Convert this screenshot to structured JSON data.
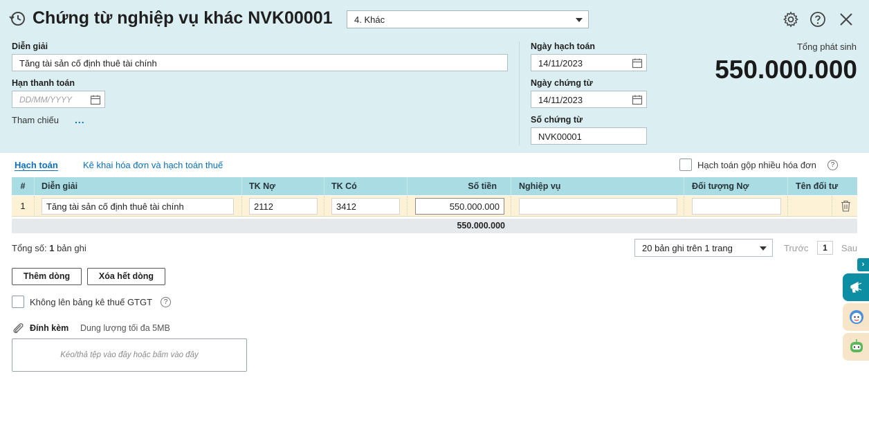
{
  "header": {
    "title": "Chứng từ nghiệp vụ khác NVK00001",
    "type_select": "4. Khác",
    "icons": [
      "history-icon",
      "gear-icon",
      "help-icon",
      "close-icon"
    ]
  },
  "form": {
    "description_label": "Diễn giải",
    "description_value": "Tăng tài sản cố định thuê tài chính",
    "due_date_label": "Hạn thanh toán",
    "due_date_placeholder": "DD/MM/YYYY",
    "reference_label": "Tham chiếu",
    "reference_more": "...",
    "posting_date_label": "Ngày hạch toán",
    "posting_date_value": "14/11/2023",
    "voucher_date_label": "Ngày chứng từ",
    "voucher_date_value": "14/11/2023",
    "voucher_no_label": "Số chứng từ",
    "voucher_no_value": "NVK00001",
    "total_label": "Tổng phát sinh",
    "total_value": "550.000.000"
  },
  "tabs": [
    {
      "label": "Hạch toán",
      "active": true
    },
    {
      "label": "Kê khai hóa đơn và hạch toán thuế",
      "active": false
    }
  ],
  "combine_invoices_label": "Hạch toán gộp nhiều hóa đơn",
  "grid": {
    "columns": [
      "#",
      "Diễn giải",
      "TK Nợ",
      "TK Có",
      "Số tiền",
      "Nghiệp vụ",
      "Đối tượng Nợ",
      "Tên đối tư"
    ],
    "rows": [
      {
        "no": "1",
        "description": "Tăng tài sản cố định thuê tài chính",
        "debit_account": "2112",
        "credit_account": "3412",
        "amount": "550.000.000",
        "operation": "",
        "debit_object": "",
        "object_name": ""
      }
    ],
    "total_amount": "550.000.000"
  },
  "summary": {
    "prefix": "Tổng số:",
    "count": "1",
    "suffix": "bản ghi"
  },
  "pager": {
    "page_size": "20 bản ghi trên 1 trang",
    "prev": "Trước",
    "page": "1",
    "next": "Sau"
  },
  "buttons": {
    "add_row": "Thêm dòng",
    "delete_all": "Xóa hết dòng"
  },
  "vat_checkbox_label": "Không lên bảng kê thuế GTGT",
  "attachment": {
    "label": "Đính kèm",
    "limit": "Dung lượng tối đa 5MB",
    "drop_text": "Kéo/thả tệp vào đây hoặc bấm vào đây"
  },
  "colors": {
    "header_bg": "#dbeef1",
    "grid_header_bg": "#a9dce3",
    "row_bg": "#fdf2d6",
    "link": "#0a6fb8",
    "accent": "#0d8ea3"
  }
}
